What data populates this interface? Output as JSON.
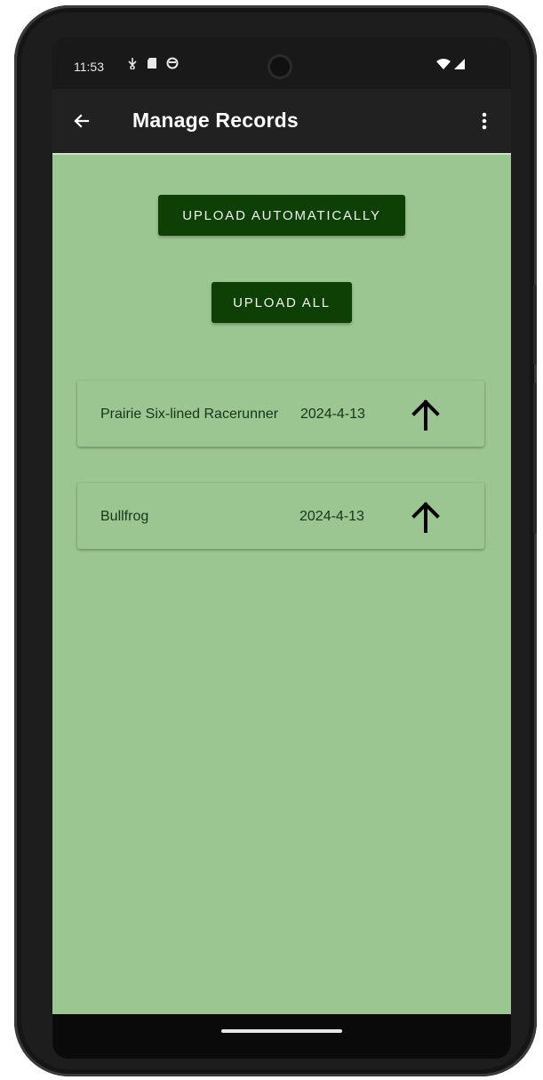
{
  "status_bar": {
    "time": "11:53",
    "icons": [
      "usb-icon",
      "sd-card-icon",
      "sync-icon"
    ],
    "right_icons": [
      "wifi-icon",
      "signal-icon"
    ]
  },
  "app_bar": {
    "back_icon": "arrow-back-icon",
    "title": "Manage Records",
    "menu_icon": "more-vert-icon"
  },
  "buttons": {
    "upload_automatically": "UPLOAD AUTOMATICALLY",
    "upload_all": "UPLOAD ALL"
  },
  "records": [
    {
      "name": "Prairie Six-lined Racerunner",
      "date": "2024-4-13",
      "action_icon": "arrow-upward-icon"
    },
    {
      "name": "Bullfrog",
      "date": "2024-4-13",
      "action_icon": "arrow-upward-icon"
    }
  ],
  "colors": {
    "content_background": "#9bc591",
    "button_background": "#0e3f05",
    "app_bar": "#212121",
    "status_bar": "#191919"
  }
}
